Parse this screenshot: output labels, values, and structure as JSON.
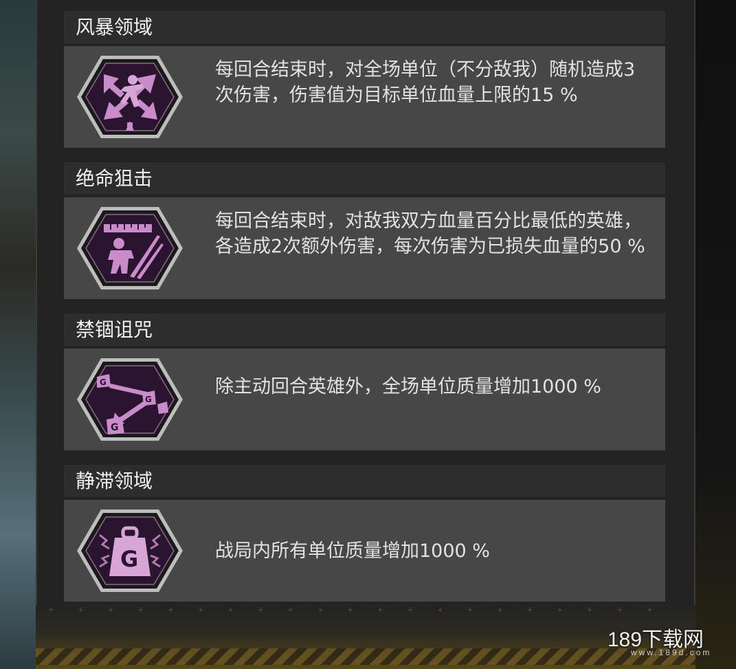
{
  "abilities": [
    {
      "title": "风暴领域",
      "description": "每回合结束时，对全场单位（不分敌我）随机造成3次伤害，伤害值为目标单位血量上限的15 %",
      "icon": "storm-burst-icon"
    },
    {
      "title": "绝命狙击",
      "description": "每回合结束时，对敌我双方血量百分比最低的英雄，各造成2次额外伤害，每次伤害为已损失血量的50 %",
      "icon": "sniper-slash-icon"
    },
    {
      "title": "禁锢诅咒",
      "description": "除主动回合英雄外，全场单位质量增加1000 %",
      "icon": "weight-arrows-icon"
    },
    {
      "title": "静滞领域",
      "description": "战局内所有单位质量增加1000 %",
      "icon": "weight-lightning-icon"
    }
  ],
  "watermark": {
    "text": "189下载网",
    "sub": "www.189d.com"
  },
  "colors": {
    "icon_accent": "#c98bc9",
    "icon_dark": "#2a1430",
    "panel": "#474747",
    "header": "#2d2d2d"
  }
}
